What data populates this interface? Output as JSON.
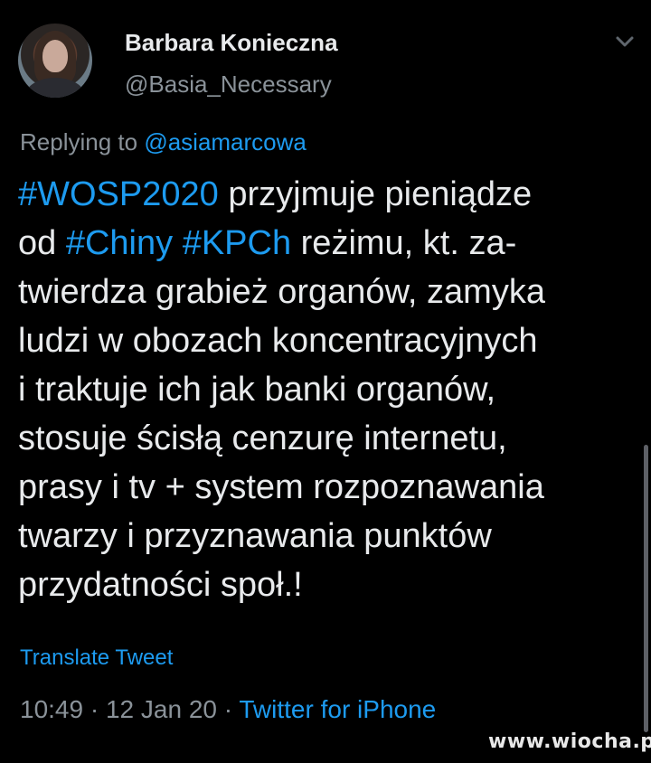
{
  "author": {
    "name": "Barbara Konieczna",
    "handle": "@Basia_Necessary"
  },
  "reply": {
    "prefix": "Replying to",
    "to": "@asiamarcowa"
  },
  "tweet": {
    "lines": [
      [
        {
          "t": "#WOSP2020",
          "tag": true
        },
        {
          "t": " przyjmuje pieniądze",
          "tag": false
        }
      ],
      [
        {
          "t": "od ",
          "tag": false
        },
        {
          "t": "#Chiny",
          "tag": true
        },
        {
          "t": " ",
          "tag": false
        },
        {
          "t": "#KPCh",
          "tag": true
        },
        {
          "t": " reżimu, kt. za-",
          "tag": false
        }
      ],
      [
        {
          "t": "twierdza grabież organów, zamyka",
          "tag": false
        }
      ],
      [
        {
          "t": "ludzi w obozach koncentracyjnych",
          "tag": false
        }
      ],
      [
        {
          "t": "i traktuje ich jak banki organów,",
          "tag": false
        }
      ],
      [
        {
          "t": "stosuje ścisłą cenzurę internetu,",
          "tag": false
        }
      ],
      [
        {
          "t": "prasy i tv + system rozpoznawania",
          "tag": false
        }
      ],
      [
        {
          "t": "twarzy i przyznawania punktów",
          "tag": false
        }
      ],
      [
        {
          "t": "przydatności społ.!",
          "tag": false
        }
      ]
    ]
  },
  "translate_label": "Translate Tweet",
  "meta": {
    "time": "10:49",
    "date": "12 Jan 20",
    "separator": " · ",
    "source": "Twitter for iPhone"
  },
  "watermark": "www.wiocha.pl",
  "icons": {
    "more": "chevron-down-icon"
  },
  "colors": {
    "background": "#000000",
    "link": "#1d9bf0",
    "text": "#e8eaec",
    "muted": "#8a9299"
  }
}
